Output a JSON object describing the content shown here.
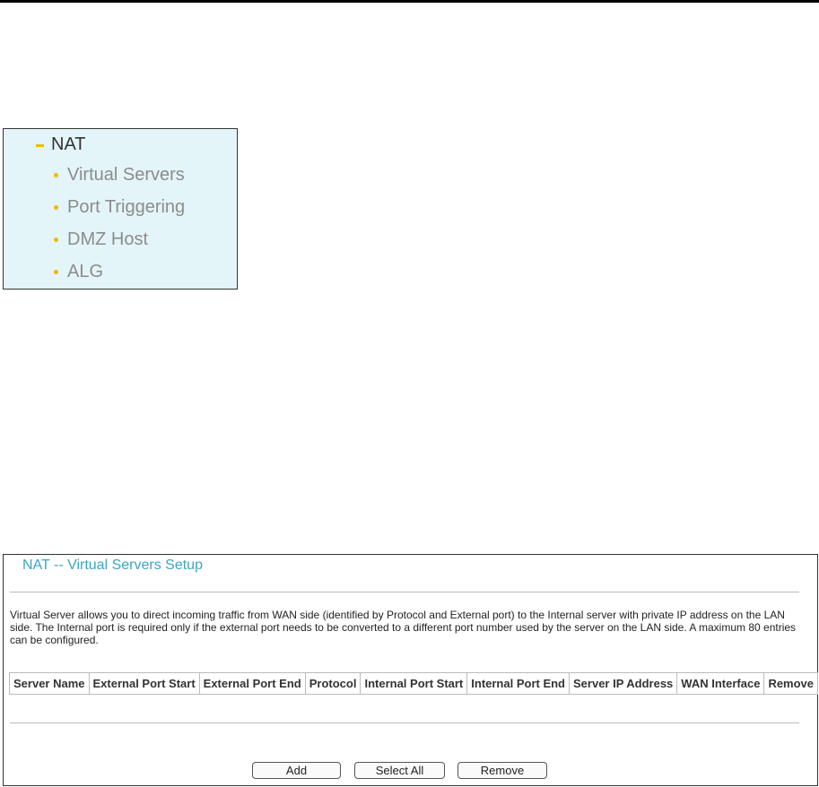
{
  "menu": {
    "header": "NAT",
    "items": [
      {
        "label": "Virtual Servers"
      },
      {
        "label": "Port Triggering"
      },
      {
        "label": "DMZ Host"
      },
      {
        "label": "ALG"
      }
    ]
  },
  "setup": {
    "title": "NAT -- Virtual Servers Setup",
    "description": "Virtual Server allows you to direct incoming traffic from WAN side (identified by Protocol and External port) to the Internal server with private IP address on the LAN side. The Internal port is required only if the external port needs to be converted to a different port number used by the server on the LAN side. A maximum 80 entries can be configured.",
    "columns": [
      "Server Name",
      "External Port Start",
      "External Port End",
      "Protocol",
      "Internal Port Start",
      "Internal Port End",
      "Server IP Address",
      "WAN Interface",
      "Remove"
    ],
    "buttons": {
      "add": "Add",
      "select_all": "Select All",
      "remove": "Remove"
    }
  },
  "colors": {
    "menu_background": "#e3f5f8",
    "accent_bullet": "#f2b800",
    "title_color": "#3aa6c2"
  }
}
